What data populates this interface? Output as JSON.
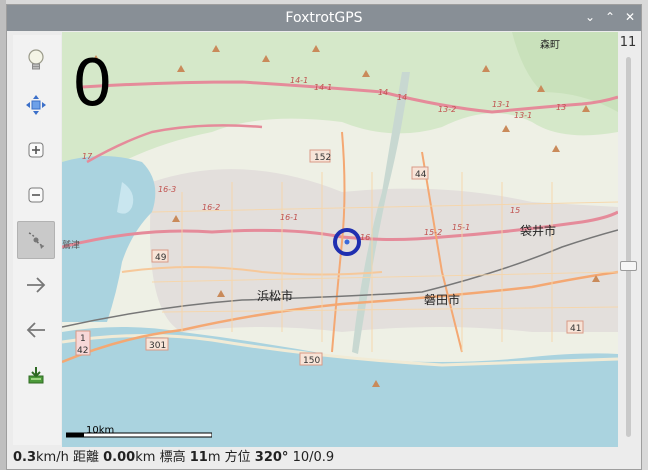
{
  "window": {
    "title": "FoxtrotGPS"
  },
  "titlebar_buttons": {
    "minimize": "⌄",
    "maximize": "⌃",
    "close": "✕"
  },
  "toolbar": [
    {
      "name": "lightbulb-icon"
    },
    {
      "name": "autocenter-icon"
    },
    {
      "name": "zoom-in-icon"
    },
    {
      "name": "zoom-out-icon"
    },
    {
      "name": "gps-track-icon",
      "active": true
    },
    {
      "name": "forward-arrow-icon"
    },
    {
      "name": "back-arrow-icon"
    },
    {
      "name": "download-icon"
    }
  ],
  "map": {
    "speed_display": "0",
    "scale_label": "10km",
    "zoom_level": "11",
    "zoom_position": 0.55,
    "labels": {
      "morimachi": "森町",
      "fukuroi": "袋井市",
      "hamamatsu": "浜松市",
      "iwata": "磐田市",
      "washizu": "鷲津"
    },
    "route_shields": [
      "152",
      "44",
      "49",
      "1",
      "42",
      "301",
      "150",
      "41"
    ],
    "road_numbers": [
      "14-1",
      "14-1",
      "14",
      "14",
      "13-2",
      "13-1",
      "13-1",
      "13",
      "17",
      "16-3",
      "16-2",
      "16-1",
      "16",
      "15-2",
      "15-1",
      "15"
    ]
  },
  "status": {
    "speed": "0.3",
    "speed_unit": "km/h",
    "distance_label": "距離",
    "distance": "0.00",
    "distance_unit": "km",
    "altitude_label": "標高",
    "altitude": "11",
    "altitude_unit": "m",
    "heading_label": "方位",
    "heading": "320°",
    "satellites": "10/0.9"
  }
}
